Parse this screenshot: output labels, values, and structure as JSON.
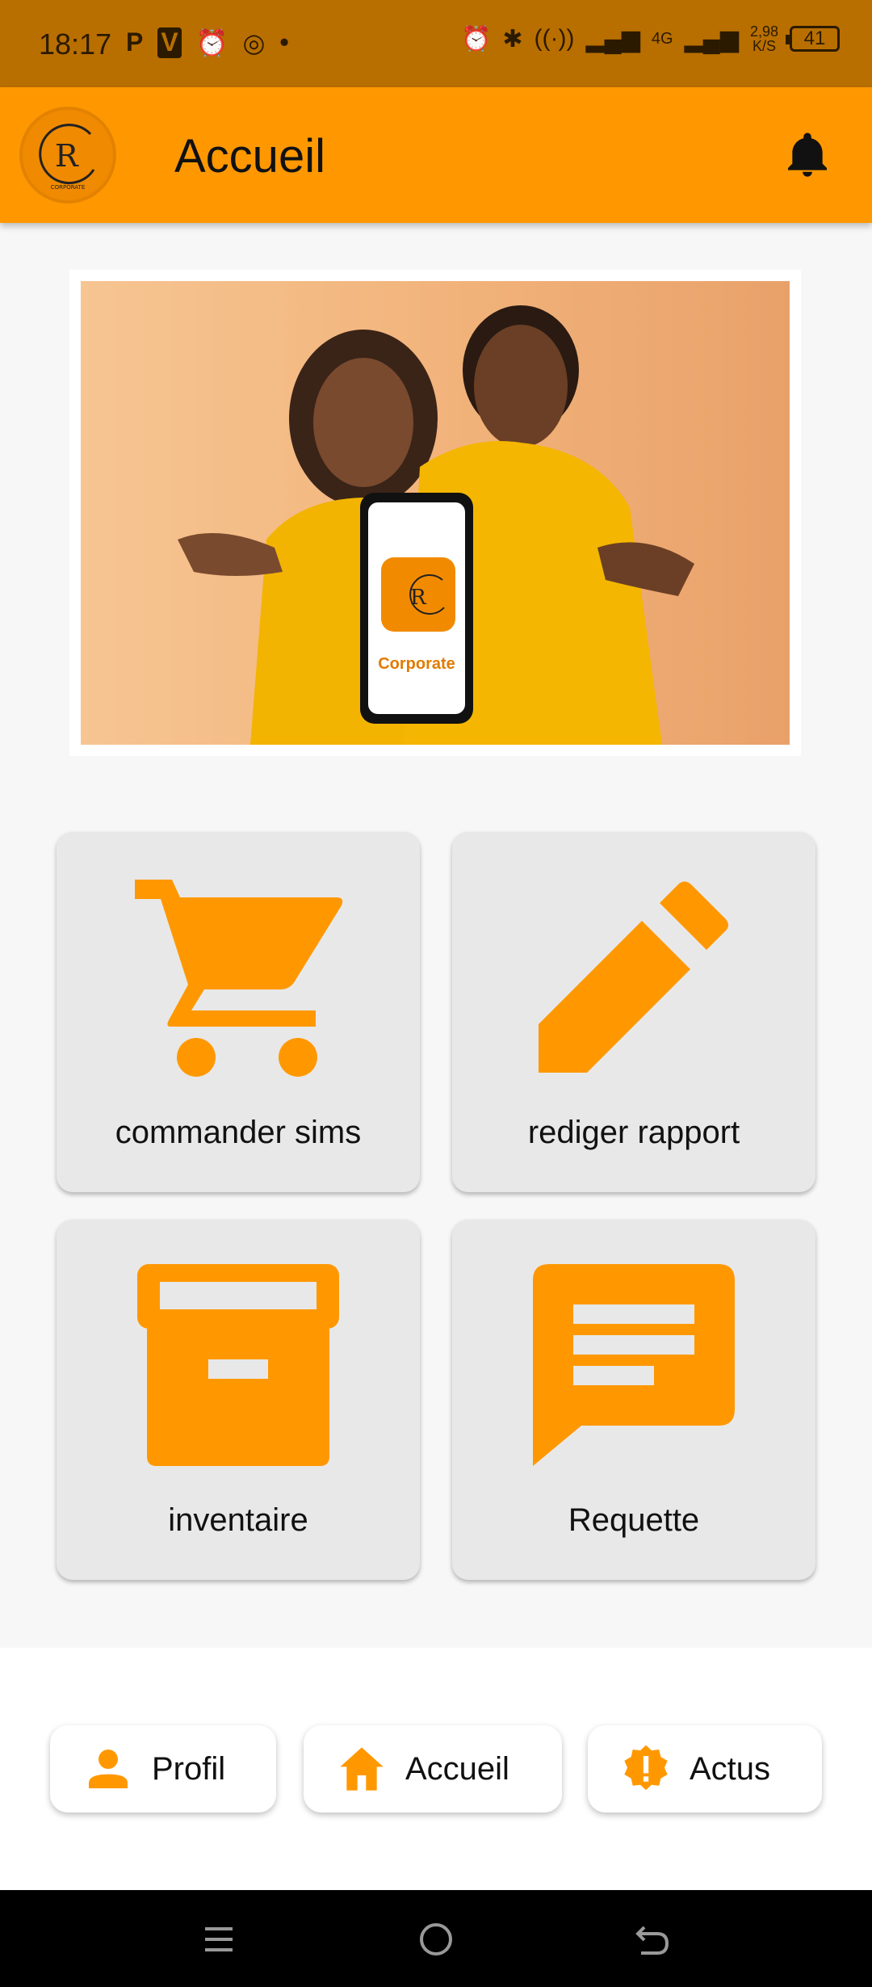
{
  "status_bar": {
    "time": "18:17",
    "left_icons": [
      "P",
      "V",
      "alarm-icon",
      "chrome-icon",
      "dot-icon"
    ],
    "net_speed_value": "2,98",
    "net_speed_unit": "K/S",
    "network_type": "4G",
    "battery": "41"
  },
  "app_bar": {
    "title": "Accueil",
    "logo_letter": "R",
    "logo_subtext": "CORPORATE"
  },
  "banner": {
    "phone_text": "Corporate",
    "logo_letter": "R"
  },
  "tiles": [
    {
      "label": "commander sims",
      "icon": "cart-icon"
    },
    {
      "label": "rediger rapport",
      "icon": "pencil-icon"
    },
    {
      "label": "inventaire",
      "icon": "archive-icon"
    },
    {
      "label": "Requette",
      "icon": "message-icon"
    }
  ],
  "bottom_nav": [
    {
      "label": "Profil",
      "icon": "person-icon"
    },
    {
      "label": "Accueil",
      "icon": "home-icon"
    },
    {
      "label": "Actus",
      "icon": "alert-badge-icon"
    }
  ],
  "colors": {
    "accent": "#ff9800",
    "status_bar": "#b86f00",
    "tile_bg": "#e8e8e8"
  }
}
